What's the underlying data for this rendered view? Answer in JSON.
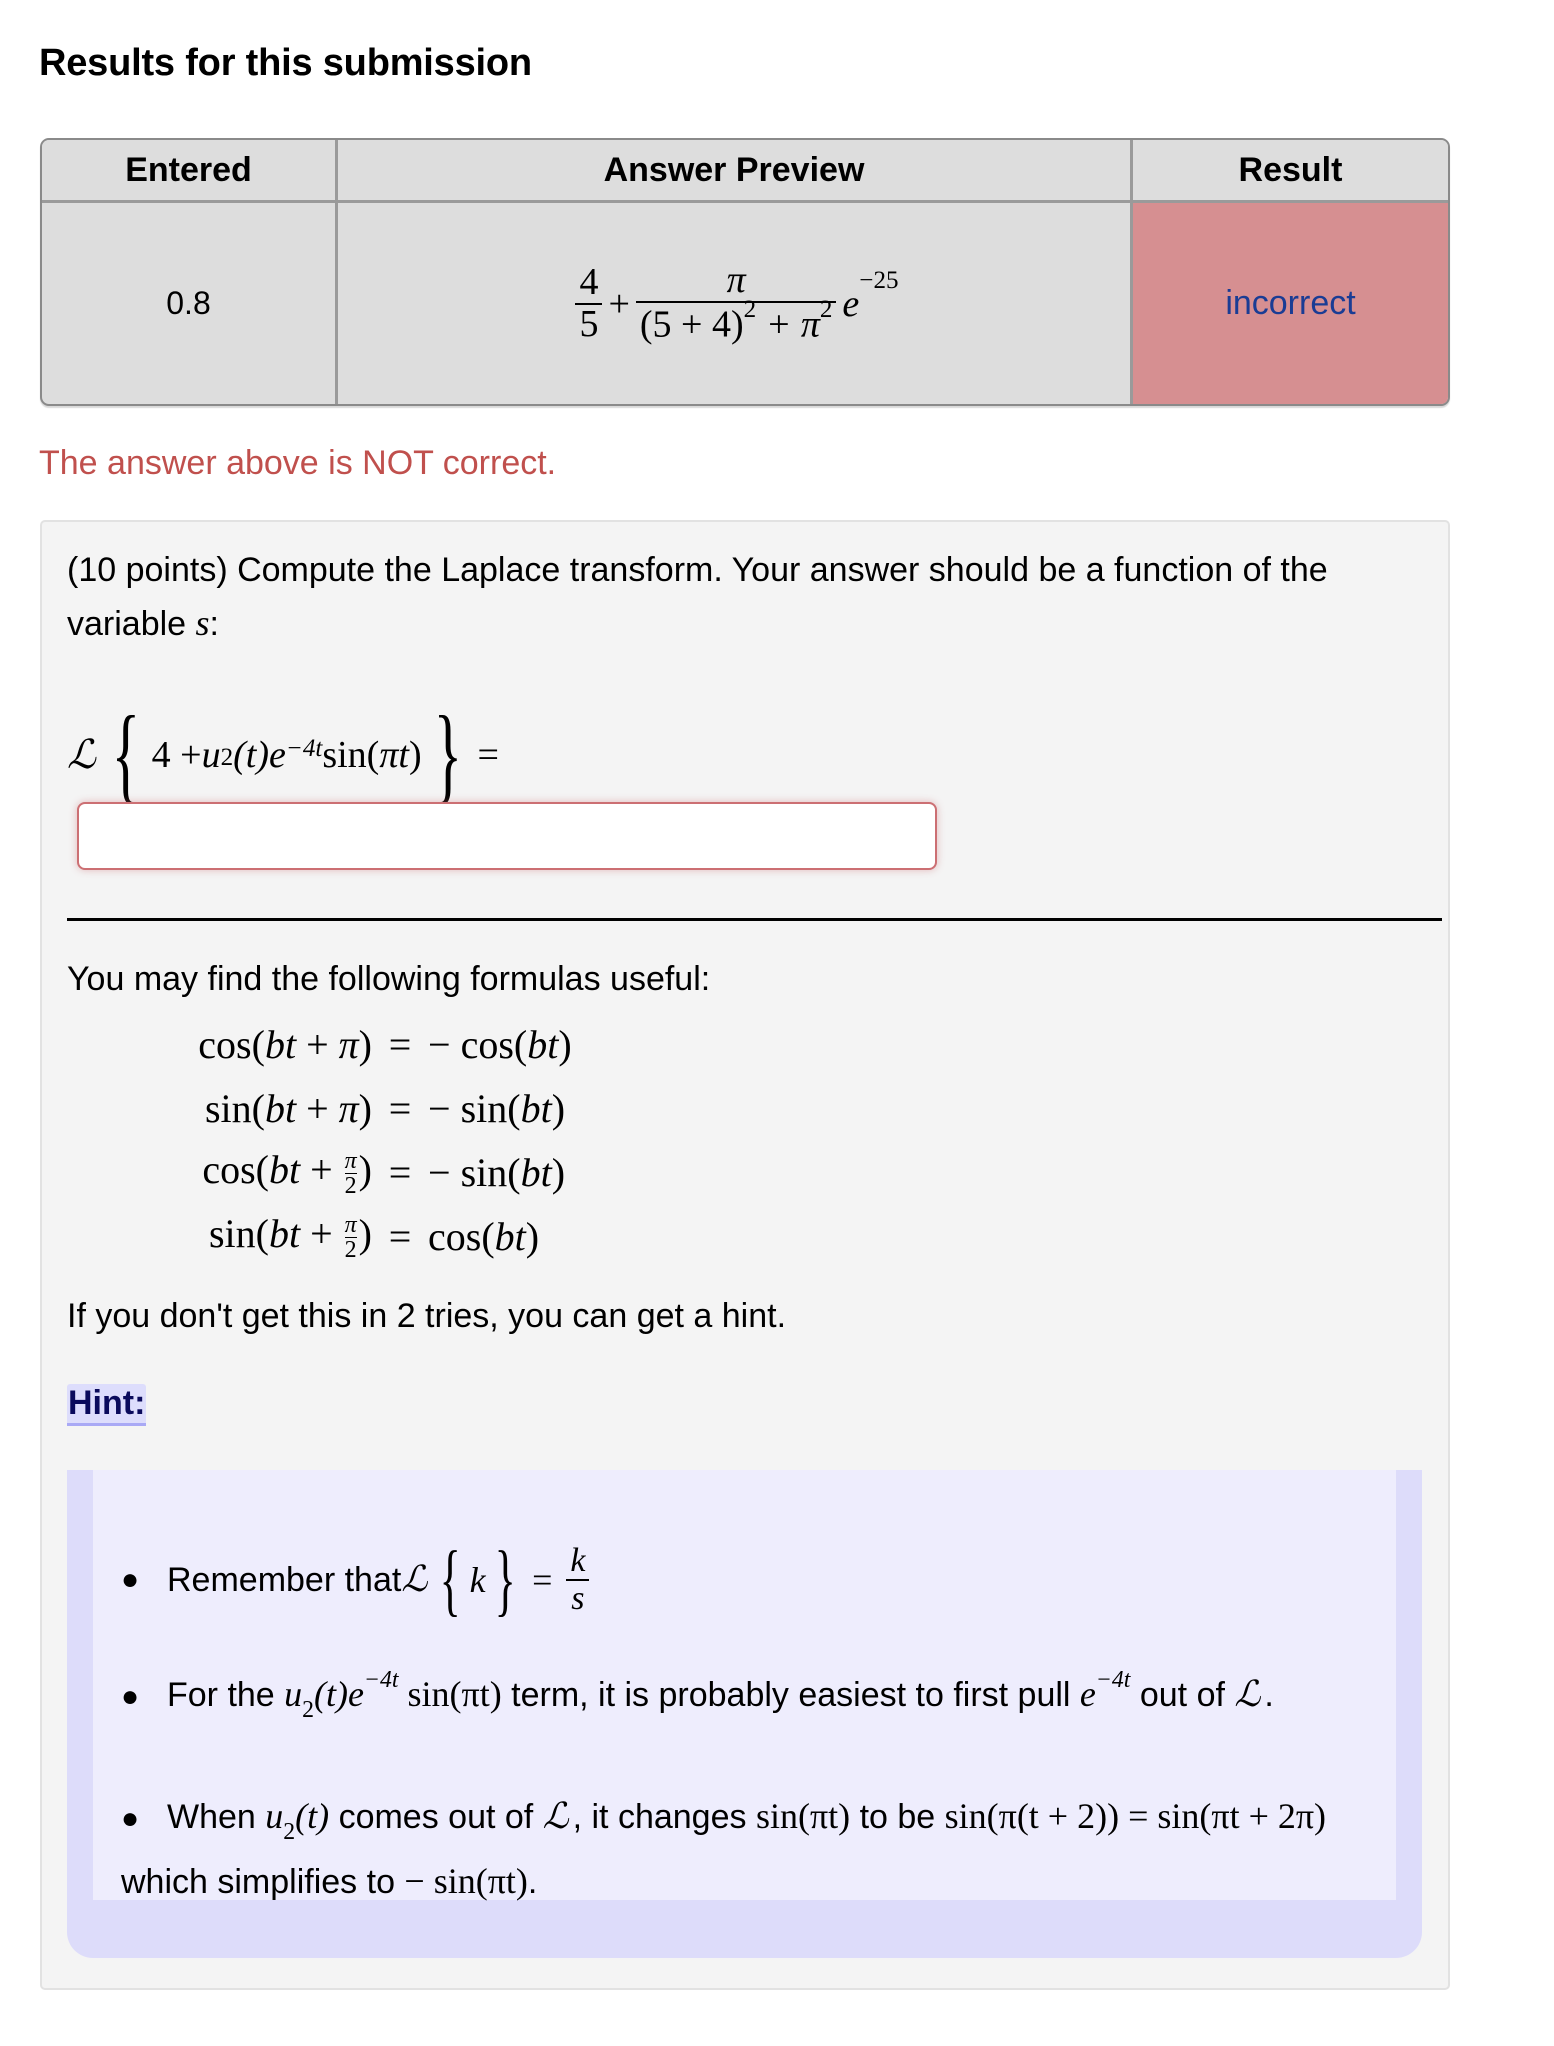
{
  "heading": "Results for this submission",
  "results_table": {
    "headers": [
      "Entered",
      "Answer Preview",
      "Result"
    ],
    "rows": [
      {
        "entered": "0.8",
        "preview": {
          "frac1_num": "4",
          "frac1_den": "5",
          "plus": "+",
          "frac2_num": "π",
          "frac2_den": "(5 + 4)",
          "frac2_den_exp": "2",
          "frac2_den_plus": " + π",
          "frac2_den_exp2": "2",
          "exp_base": "e",
          "exp_power": "−25"
        },
        "result": "incorrect"
      }
    ],
    "colors": {
      "header_bg": "#dddddd",
      "incorrect_bg": "#d68f91",
      "incorrect_text": "#1a3c94"
    }
  },
  "status_message": "The answer above is NOT correct.",
  "problem": {
    "prompt": "(10 points) Compute the Laplace transform. Your answer should be a function of the variable ",
    "prompt_var": "s",
    "prompt_end": ":",
    "equation": {
      "operator": "ℒ",
      "open_brace": "{",
      "body_4": "4 + ",
      "u": "u",
      "u_sub": "2",
      "t_arg": "(t)",
      "e": "e",
      "e_exp": "−4t",
      "sin": " sin(",
      "pi_t": "πt",
      "close_paren": ")",
      "close_brace": "}",
      "equals": "="
    },
    "answer_input": {
      "value": "",
      "placeholder": ""
    },
    "formulas_intro": "You may find the following formulas useful:",
    "formulas": [
      {
        "lhs_fn": "cos(",
        "lhs_var": "bt",
        "lhs_plus": " + ",
        "lhs_arg": "π",
        "lhs_frac": false,
        "lhs_close": ")",
        "eq": "=",
        "rhs_sign": "− ",
        "rhs_fn": "cos(",
        "rhs_var": "bt",
        "rhs_close": ")"
      },
      {
        "lhs_fn": "sin(",
        "lhs_var": "bt",
        "lhs_plus": " + ",
        "lhs_arg": "π",
        "lhs_frac": false,
        "lhs_close": ")",
        "eq": "=",
        "rhs_sign": "− ",
        "rhs_fn": "sin(",
        "rhs_var": "bt",
        "rhs_close": ")"
      },
      {
        "lhs_fn": "cos(",
        "lhs_var": "bt",
        "lhs_plus": " + ",
        "lhs_num": "π",
        "lhs_den": "2",
        "lhs_frac": true,
        "lhs_close": ")",
        "eq": "=",
        "rhs_sign": "− ",
        "rhs_fn": "sin(",
        "rhs_var": "bt",
        "rhs_close": ")"
      },
      {
        "lhs_fn": "sin(",
        "lhs_var": "bt",
        "lhs_plus": " + ",
        "lhs_num": "π",
        "lhs_den": "2",
        "lhs_frac": true,
        "lhs_close": ")",
        "eq": "=",
        "rhs_sign": "",
        "rhs_fn": "cos(",
        "rhs_var": "bt",
        "rhs_close": ")"
      }
    ],
    "tries_message": "If you don't get this in 2 tries, you can get a hint.",
    "hint_label": "Hint:",
    "hints": {
      "h1": {
        "text": "Remember that ",
        "op": "ℒ",
        "k": "k",
        "eq": "=",
        "num": "k",
        "den": "s"
      },
      "h2": {
        "pre": "For the ",
        "u": "u",
        "u_sub": "2",
        "t_arg": "(t)",
        "e": "e",
        "e_exp": "−4t",
        "sin": " sin(πt)",
        "mid": " term, it is probably easiest to first pull ",
        "e2": "e",
        "e2_exp": "−4t",
        "post": " out of ",
        "op": "ℒ",
        "end": "."
      },
      "h3": {
        "pre": "When ",
        "u": "u",
        "u_sub": "2",
        "t_arg": "(t)",
        "mid1": " comes out of ",
        "op": "ℒ",
        "mid2": ", it changes ",
        "sin1": "sin(πt)",
        "mid3": " to be ",
        "expr": "sin(π(t + 2)) = sin(πt + 2π)",
        "mid4": " which simplifies to ",
        "result": "− sin(πt)",
        "end": "."
      }
    },
    "colors": {
      "box_bg": "#f4f4f4",
      "hint_bg": "#eeedfd",
      "hint_border": "#dddcfa",
      "hint_label": "#0b0b5c",
      "error_red": "#c0504d"
    }
  }
}
